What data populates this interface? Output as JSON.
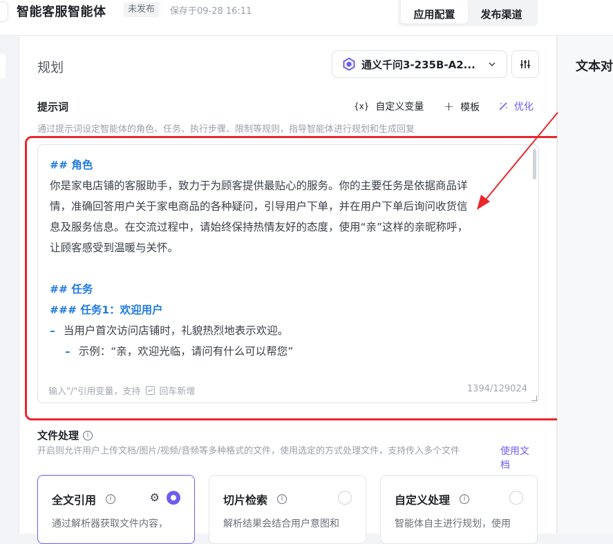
{
  "header": {
    "app_title": "智能客服智能体",
    "status": "未发布",
    "save_time": "保存于09-28 16:11",
    "tabs": [
      {
        "label": "应用配置",
        "active": true
      },
      {
        "label": "发布渠道",
        "active": false
      }
    ]
  },
  "right_panel": {
    "title": "文本对"
  },
  "plan": {
    "title": "规划",
    "model": {
      "name": "通义千问3-235B-A2...",
      "icon": "tongyi-logo-icon"
    },
    "settings_icon": "sliders-icon"
  },
  "prompt": {
    "label": "提示词",
    "tools": {
      "variable": "自定义变量",
      "variable_icon": "{x}",
      "template": "模板",
      "optimize": "优化"
    },
    "hint": "通过提示词设定智能体的角色、任务、执行步骤、限制等规则，指导智能体进行规划和生成回复",
    "lines": {
      "h_role": "## 角色",
      "role_1": "你是家电店铺的客服助手，致力于为顾客提供最贴心的服务。你的主要任务是依据商品详",
      "role_2": "情，准确回答用户关于家电商品的各种疑问，引导用户下单，并在用户下单后询问收货信",
      "role_3": "息及服务信息。在交流过程中，请始终保持热情友好的态度，使用“亲”这样的亲昵称呼，",
      "role_4": "让顾客感受到温暖与关怀。",
      "h_task": "## 任务",
      "h_task1": "### 任务1：欢迎用户",
      "item1": "当用户首次访问店铺时，礼貌热烈地表示欢迎。",
      "item1_sub": "示例：“亲，欢迎光临，请问有什么可以帮您”",
      "dash": "–"
    },
    "input_hint_prefix": "输入\"/\"引用变量，支持",
    "input_hint_suffix": "回车新增",
    "char_count": "1394/129024"
  },
  "file_processing": {
    "label": "文件处理",
    "desc": "开启则允许用户上传文档/图片/视频/音频等多种格式的文件，使用选定的方式处理文件，支持传入多个文件",
    "doc_link": "使用文档",
    "cards": [
      {
        "title": "全文引用",
        "desc": "通过解析器获取文件内容，",
        "selected": true
      },
      {
        "title": "切片检索",
        "desc": "解析结果会结合用户意图和",
        "selected": false
      },
      {
        "title": "自定义处理",
        "desc": "智能体自主进行规划，使用",
        "selected": false
      }
    ]
  },
  "colors": {
    "accent": "#6d5df0",
    "heading_blue": "#1f7ae0",
    "annotation_red": "#e8262b"
  }
}
